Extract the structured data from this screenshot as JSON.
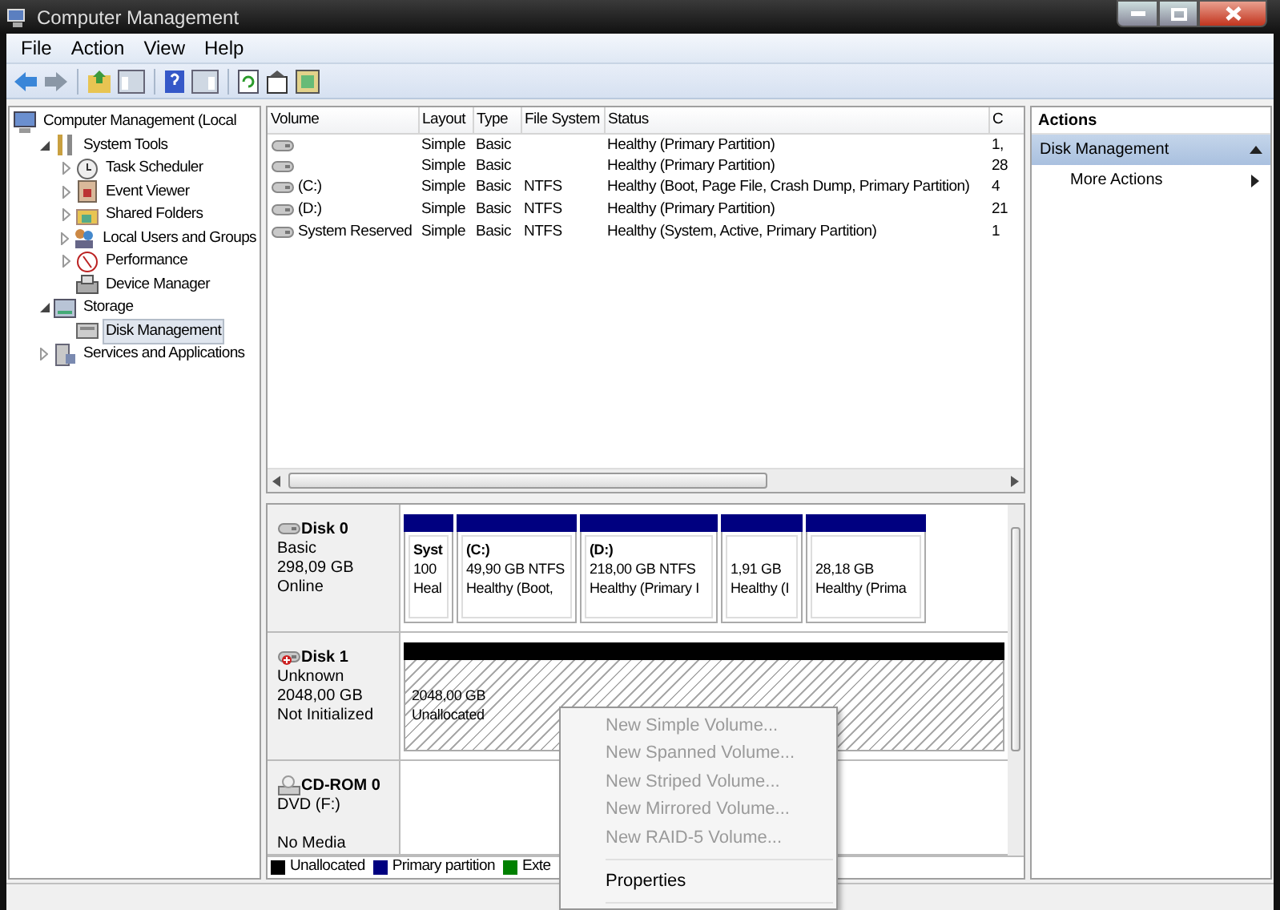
{
  "window": {
    "title": "Computer Management"
  },
  "menu_bar": [
    "File",
    "Action",
    "View",
    "Help"
  ],
  "tree": [
    {
      "label": "Computer Management (Local",
      "selected": false,
      "children": [
        {
          "label": "System Tools",
          "selected": false,
          "expanded": true,
          "children": [
            {
              "label": "Task Scheduler",
              "selected": false,
              "expanded": false
            },
            {
              "label": "Event Viewer",
              "selected": false,
              "expanded": false
            },
            {
              "label": "Shared Folders",
              "selected": false,
              "expanded": false
            },
            {
              "label": "Local Users and Groups",
              "selected": false,
              "expanded": false
            },
            {
              "label": "Performance",
              "selected": false,
              "expanded": false
            },
            {
              "label": "Device Manager",
              "selected": false
            }
          ]
        },
        {
          "label": "Storage",
          "selected": false,
          "expanded": true,
          "children": [
            {
              "label": "Disk Management",
              "selected": true
            }
          ]
        },
        {
          "label": "Services and Applications",
          "selected": false,
          "expanded": false
        }
      ]
    }
  ],
  "volume_table": {
    "columns": [
      "Volume",
      "Layout",
      "Type",
      "File System",
      "Status",
      "C"
    ],
    "rows": [
      {
        "layout": "Simple",
        "type": "Basic",
        "status": "Healthy (Primary Partition)",
        "column_6": "1,"
      },
      {
        "layout": "Simple",
        "type": "Basic",
        "status": "Healthy (Primary Partition)",
        "column_6": "28"
      },
      {
        "volume": "(C:)",
        "layout": "Simple",
        "type": "Basic",
        "file_system": "NTFS",
        "status": "Healthy (Boot, Page File, Crash Dump, Primary Partition)",
        "column_6": "4"
      },
      {
        "volume": "(D:)",
        "layout": "Simple",
        "type": "Basic",
        "file_system": "NTFS",
        "status": "Healthy (Primary Partition)",
        "column_6": "21"
      },
      {
        "volume": "System Reserved",
        "layout": "Simple",
        "type": "Basic",
        "file_system": "NTFS",
        "status": "Healthy (System, Active, Primary Partition)",
        "column_6": "1"
      }
    ]
  },
  "disks": [
    {
      "kind": "disk",
      "name": "Disk 0",
      "lines": [
        "Basic",
        "298,09 GB",
        "Online"
      ],
      "partitions": [
        {
          "lines": [
            "Syst",
            "100",
            "Heal"
          ],
          "color": "#000080"
        },
        {
          "lines": [
            "(C:)",
            "49,90 GB NTFS",
            "Healthy (Boot,"
          ],
          "color": "#000080"
        },
        {
          "lines": [
            "(D:)",
            "218,00 GB NTFS",
            "Healthy (Primary I"
          ],
          "color": "#000080"
        },
        {
          "lines": [
            "1,91 GB",
            "Healthy (I"
          ],
          "color": "#000080"
        },
        {
          "lines": [
            "28,18 GB",
            "Healthy (Prima"
          ],
          "color": "#000080"
        }
      ]
    },
    {
      "kind": "uninitialized",
      "name": "Disk 1",
      "lines": [
        "Unknown",
        "2048,00 GB",
        "Not Initialized"
      ],
      "partitions": [
        {
          "lines": [
            "2048,00 GB",
            "Unallocated"
          ],
          "color": "#000000"
        }
      ]
    },
    {
      "kind": "cdrom",
      "name": "CD-ROM 0",
      "lines": [
        "DVD (F:)",
        "No Media"
      ]
    }
  ],
  "legend": [
    {
      "label": "Unallocated",
      "color": "#000000"
    },
    {
      "label": "Primary partition",
      "color": "#000080"
    },
    {
      "label": "Exte",
      "color": "#008000"
    }
  ],
  "actions": {
    "title": "Actions",
    "section": {
      "label": "Disk Management",
      "expanded": true
    },
    "items": [
      "More Actions"
    ]
  },
  "context_menu": [
    {
      "label": "New Simple Volume...",
      "disabled": true
    },
    {
      "label": "New Spanned Volume...",
      "disabled": true
    },
    {
      "label": "New Striped Volume...",
      "disabled": true
    },
    {
      "label": "New Mirrored Volume...",
      "disabled": true
    },
    {
      "label": "New RAID-5 Volume...",
      "disabled": true
    },
    {
      "kind": "separator"
    },
    {
      "label": "Properties",
      "disabled": false
    },
    {
      "kind": "separator"
    }
  ]
}
